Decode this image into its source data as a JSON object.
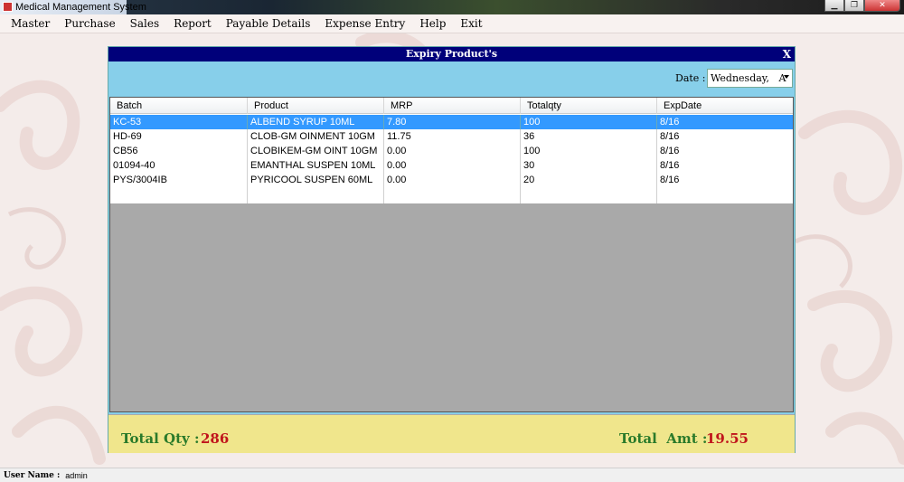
{
  "window": {
    "title": "Medical Management System"
  },
  "menu": [
    "Master",
    "Purchase",
    "Sales",
    "Report",
    "Payable Details",
    "Expense Entry",
    "Help",
    "Exit"
  ],
  "dialog": {
    "title": "Expiry Product's",
    "close_label": "X",
    "date_label": "Date :",
    "date_value": "Wednesday,   A"
  },
  "grid": {
    "columns": [
      "Batch",
      "Product",
      "MRP",
      "Totalqty",
      "ExpDate"
    ],
    "rows": [
      {
        "batch": "KC-53",
        "product": "ALBEND SYRUP 10ML",
        "mrp": "7.80",
        "totalqty": "100",
        "expdate": "8/16",
        "selected": true
      },
      {
        "batch": "HD-69",
        "product": "CLOB-GM OINMENT 10GM",
        "mrp": "11.75",
        "totalqty": "36",
        "expdate": "8/16"
      },
      {
        "batch": "CB56",
        "product": "CLOBIKEM-GM OINT 10GM",
        "mrp": "0.00",
        "totalqty": "100",
        "expdate": "8/16"
      },
      {
        "batch": "01094-40",
        "product": "EMANTHAL SUSPEN 10ML",
        "mrp": "0.00",
        "totalqty": "30",
        "expdate": "8/16"
      },
      {
        "batch": "PYS/3004IB",
        "product": "PYRICOOL SUSPEN 60ML",
        "mrp": "0.00",
        "totalqty": "20",
        "expdate": "8/16"
      }
    ]
  },
  "footer": {
    "total_qty_label": "Total Qty :",
    "total_qty_value": "286",
    "total_amt_label": "Total  Amt :",
    "total_amt_value": "19.55"
  },
  "status": {
    "user_label": "User Name :",
    "user_value": "admin"
  },
  "colors": {
    "dialog_header": "#00007a",
    "dialog_bg": "#87cfea",
    "selection": "#3399ff",
    "footer_bg": "#f0e68c",
    "total_label": "#2a7a2a",
    "total_value": "#c0141c"
  }
}
